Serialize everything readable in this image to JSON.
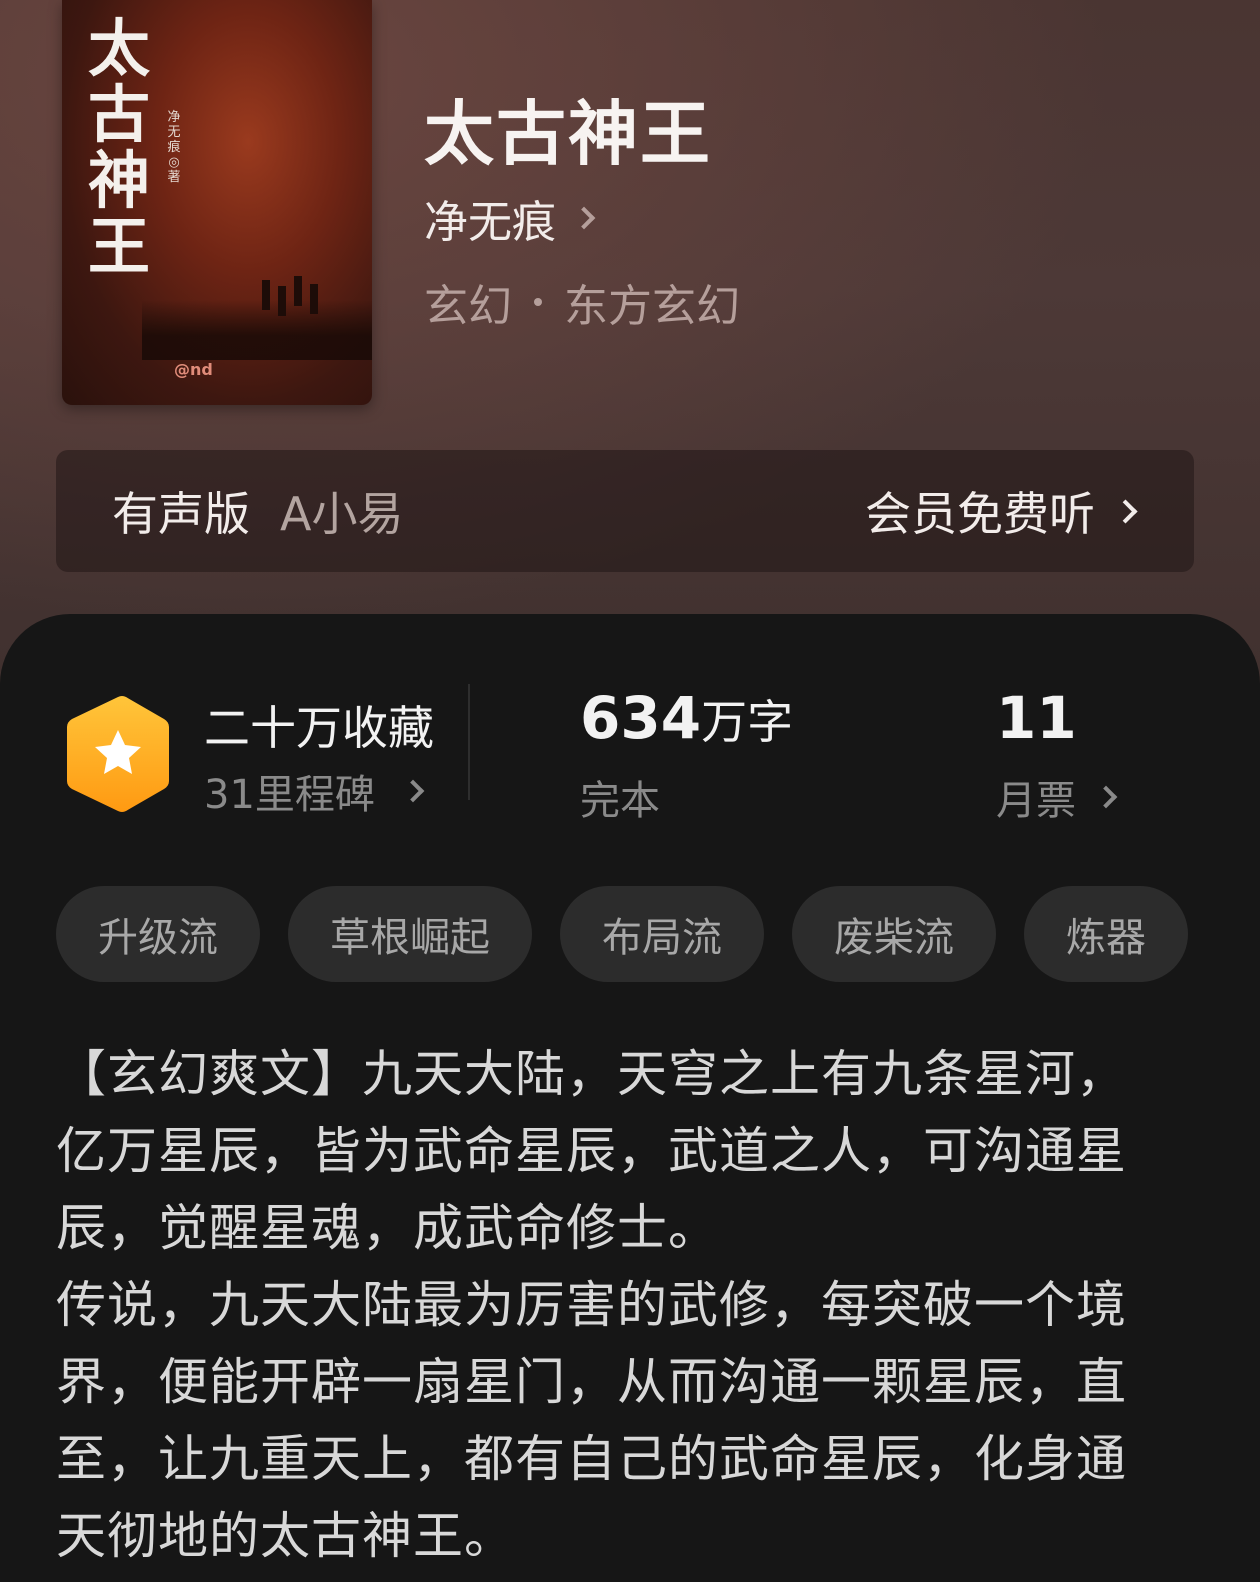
{
  "book": {
    "cover_title": "太古神王",
    "cover_author": "净无痕◎著",
    "cover_logo": "@nd",
    "title": "太古神王",
    "author": "净无痕",
    "category": "玄幻",
    "subcategory": "东方玄幻"
  },
  "audio": {
    "label": "有声版",
    "narrator": "A小易",
    "action": "会员免费听"
  },
  "stats": {
    "favorites": "二十万收藏",
    "milestones": "31里程碑",
    "word_count": "634",
    "word_unit": "万字",
    "status": "完本",
    "monthly_tickets": "11",
    "monthly_tickets_label": "月票"
  },
  "tags": [
    "升级流",
    "草根崛起",
    "布局流",
    "废柴流",
    "炼器"
  ],
  "description": "【玄幻爽文】九天大陆，天穹之上有九条星河，亿万星辰，皆为武命星辰，武道之人，可沟通星辰，觉醒星魂，成武命修士。\n传说，九天大陆最为厉害的武修，每突破一个境界，便能开辟一扇星门，从而沟通一颗星辰，直至，让九重天上，都有自己的武命星辰，化身通天彻地的太古神王。",
  "colors": {
    "header_bg": "#4a3532",
    "panel_bg": "#161616",
    "badge_orange": "#ffb01f",
    "tag_bg": "#2c2c2c"
  },
  "icons": {
    "badge": "star-hexagon-icon",
    "chevron": "chevron-right-icon"
  }
}
